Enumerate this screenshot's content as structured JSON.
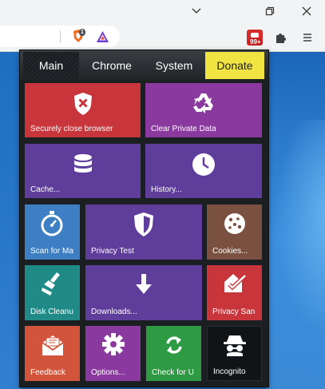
{
  "window": {
    "controls": [
      {
        "name": "tab-list-chevron-icon",
        "glyph": "⌄"
      },
      {
        "name": "restore-icon",
        "glyph": "⧉"
      },
      {
        "name": "close-icon",
        "glyph": "✕"
      }
    ]
  },
  "toolbar": {
    "brave_badge_count": "1",
    "extension_badge": "99+",
    "menu_glyph": "☰"
  },
  "popup": {
    "tabs": [
      {
        "label": "Main",
        "state": "active"
      },
      {
        "label": "Chrome",
        "state": "normal"
      },
      {
        "label": "System",
        "state": "normal"
      },
      {
        "label": "Donate",
        "state": "highlight"
      }
    ],
    "tiles": [
      {
        "id": "secure-close",
        "label": "Securely close browser",
        "icon": "shield-x-icon",
        "color": "#c8363c"
      },
      {
        "id": "clear-private",
        "label": "Clear Private Data",
        "icon": "recycle-icon",
        "color": "#8a3a9e"
      },
      {
        "id": "cache",
        "label": "Cache...",
        "icon": "database-icon",
        "color": "#5f3d9a"
      },
      {
        "id": "history",
        "label": "History...",
        "icon": "clock-icon",
        "color": "#5f3d9a"
      },
      {
        "id": "scan",
        "label": "Scan for Ma",
        "icon": "stopwatch-icon",
        "color": "#3d7fc2"
      },
      {
        "id": "privacy-test",
        "label": "Privacy Test",
        "icon": "shield-icon",
        "color": "#5f3d9a"
      },
      {
        "id": "cookies",
        "label": "Cookies...",
        "icon": "cookie-icon",
        "color": "#7a5040"
      },
      {
        "id": "disk-cleanup",
        "label": "Disk Cleanu",
        "icon": "broom-icon",
        "color": "#1f8a86"
      },
      {
        "id": "downloads",
        "label": "Downloads...",
        "icon": "download-arrow-icon",
        "color": "#5f3d9a"
      },
      {
        "id": "privacy-sandbox",
        "label": "Privacy San",
        "icon": "house-check-icon",
        "color": "#c8363c"
      },
      {
        "id": "feedback",
        "label": "Feedback",
        "icon": "envelope-icon",
        "color": "#d2553b"
      },
      {
        "id": "options",
        "label": "Options...",
        "icon": "gear-icon",
        "color": "#8a3a9e"
      },
      {
        "id": "check-update",
        "label": "Check for U",
        "icon": "refresh-icon",
        "color": "#2e9a44"
      },
      {
        "id": "incognito",
        "label": "Incognito",
        "icon": "spy-icon",
        "color": "#111417"
      }
    ]
  }
}
